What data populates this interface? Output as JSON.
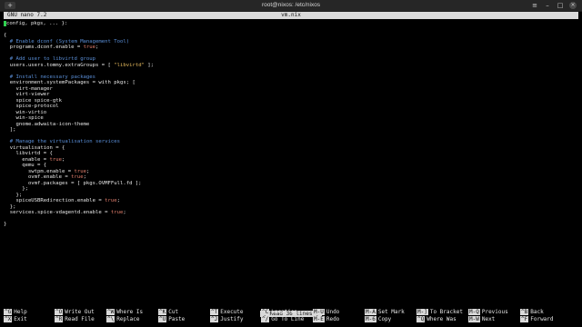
{
  "window": {
    "title": "root@nixos: /etc/nixos",
    "new_tab_glyph": "+",
    "menu_glyph": "≡",
    "minimize_glyph": "–",
    "maximize_glyph": "□",
    "close_glyph": "×"
  },
  "nano": {
    "version": "GNU nano 7.2",
    "filename": "vm.nix",
    "status": "[ Read 36 lines ]"
  },
  "code_lines": [
    [
      {
        "t": "config, pkgs, ... }:",
        "c": ""
      }
    ],
    [
      {
        "t": "",
        "c": ""
      }
    ],
    [
      {
        "t": "{",
        "c": ""
      }
    ],
    [
      {
        "t": "  # Enable dconf (System Management Tool)",
        "c": "c-comment"
      }
    ],
    [
      {
        "t": "  programs.dconf.enable = ",
        "c": ""
      },
      {
        "t": "true",
        "c": "c-val"
      },
      {
        "t": ";",
        "c": ""
      }
    ],
    [
      {
        "t": "",
        "c": ""
      }
    ],
    [
      {
        "t": "  # Add user to libvirtd group",
        "c": "c-comment"
      }
    ],
    [
      {
        "t": "  users.users.tommy.extraGroups = [ ",
        "c": ""
      },
      {
        "t": "\"libvirtd\"",
        "c": "c-str"
      },
      {
        "t": " ];",
        "c": ""
      }
    ],
    [
      {
        "t": "",
        "c": ""
      }
    ],
    [
      {
        "t": "  # Install necessary packages",
        "c": "c-comment"
      }
    ],
    [
      {
        "t": "  environment.systemPackages = with pkgs; [",
        "c": ""
      }
    ],
    [
      {
        "t": "    virt-manager",
        "c": ""
      }
    ],
    [
      {
        "t": "    virt-viewer",
        "c": ""
      }
    ],
    [
      {
        "t": "    spice spice-gtk",
        "c": ""
      }
    ],
    [
      {
        "t": "    spice-protocol",
        "c": ""
      }
    ],
    [
      {
        "t": "    win-virtio",
        "c": ""
      }
    ],
    [
      {
        "t": "    win-spice",
        "c": ""
      }
    ],
    [
      {
        "t": "    gnome.adwaita-icon-theme",
        "c": ""
      }
    ],
    [
      {
        "t": "  ];",
        "c": ""
      }
    ],
    [
      {
        "t": "",
        "c": ""
      }
    ],
    [
      {
        "t": "  # Manage the virtualisation services",
        "c": "c-comment"
      }
    ],
    [
      {
        "t": "  virtualisation = {",
        "c": ""
      }
    ],
    [
      {
        "t": "    libvirtd = {",
        "c": ""
      }
    ],
    [
      {
        "t": "      enable = ",
        "c": ""
      },
      {
        "t": "true",
        "c": "c-val"
      },
      {
        "t": ";",
        "c": ""
      }
    ],
    [
      {
        "t": "      qemu = {",
        "c": ""
      }
    ],
    [
      {
        "t": "        swtpm.enable = ",
        "c": ""
      },
      {
        "t": "true",
        "c": "c-val"
      },
      {
        "t": ";",
        "c": ""
      }
    ],
    [
      {
        "t": "        ovmf.enable = ",
        "c": ""
      },
      {
        "t": "true",
        "c": "c-val"
      },
      {
        "t": ";",
        "c": ""
      }
    ],
    [
      {
        "t": "        ovmf.packages = [ pkgs.OVMFFull.fd ];",
        "c": ""
      }
    ],
    [
      {
        "t": "      };",
        "c": ""
      }
    ],
    [
      {
        "t": "    };",
        "c": ""
      }
    ],
    [
      {
        "t": "    spiceUSBRedirection.enable = ",
        "c": ""
      },
      {
        "t": "true",
        "c": "c-val"
      },
      {
        "t": ";",
        "c": ""
      }
    ],
    [
      {
        "t": "  };",
        "c": ""
      }
    ],
    [
      {
        "t": "  services.spice-vdagentd.enable = ",
        "c": ""
      },
      {
        "t": "true",
        "c": "c-val"
      },
      {
        "t": ";",
        "c": ""
      }
    ],
    [
      {
        "t": "",
        "c": ""
      }
    ],
    [
      {
        "t": "}",
        "c": ""
      }
    ]
  ],
  "shortcuts": [
    [
      {
        "key": "^G",
        "label": "Help",
        "name": "help"
      },
      {
        "key": "^O",
        "label": "Write Out",
        "name": "write-out"
      },
      {
        "key": "^W",
        "label": "Where Is",
        "name": "where-is"
      },
      {
        "key": "^K",
        "label": "Cut",
        "name": "cut"
      },
      {
        "key": "^T",
        "label": "Execute",
        "name": "execute"
      },
      {
        "key": "^C",
        "label": "Location",
        "name": "location"
      },
      {
        "key": "M-U",
        "label": "Undo",
        "name": "undo"
      },
      {
        "key": "M-A",
        "label": "Set Mark",
        "name": "set-mark"
      },
      {
        "key": "M-]",
        "label": "To Bracket",
        "name": "to-bracket"
      },
      {
        "key": "M-Q",
        "label": "Previous",
        "name": "previous"
      },
      {
        "key": "^B",
        "label": "Back",
        "name": "back"
      }
    ],
    [
      {
        "key": "^X",
        "label": "Exit",
        "name": "exit"
      },
      {
        "key": "^R",
        "label": "Read File",
        "name": "read-file"
      },
      {
        "key": "^\\",
        "label": "Replace",
        "name": "replace"
      },
      {
        "key": "^U",
        "label": "Paste",
        "name": "paste"
      },
      {
        "key": "^J",
        "label": "Justify",
        "name": "justify"
      },
      {
        "key": "^/",
        "label": "Go To Line",
        "name": "go-to-line"
      },
      {
        "key": "M-E",
        "label": "Redo",
        "name": "redo"
      },
      {
        "key": "M-6",
        "label": "Copy",
        "name": "copy"
      },
      {
        "key": "^Q",
        "label": "Where Was",
        "name": "where-was"
      },
      {
        "key": "M-W",
        "label": "Next",
        "name": "next"
      },
      {
        "key": "^F",
        "label": "Forward",
        "name": "forward"
      }
    ]
  ]
}
